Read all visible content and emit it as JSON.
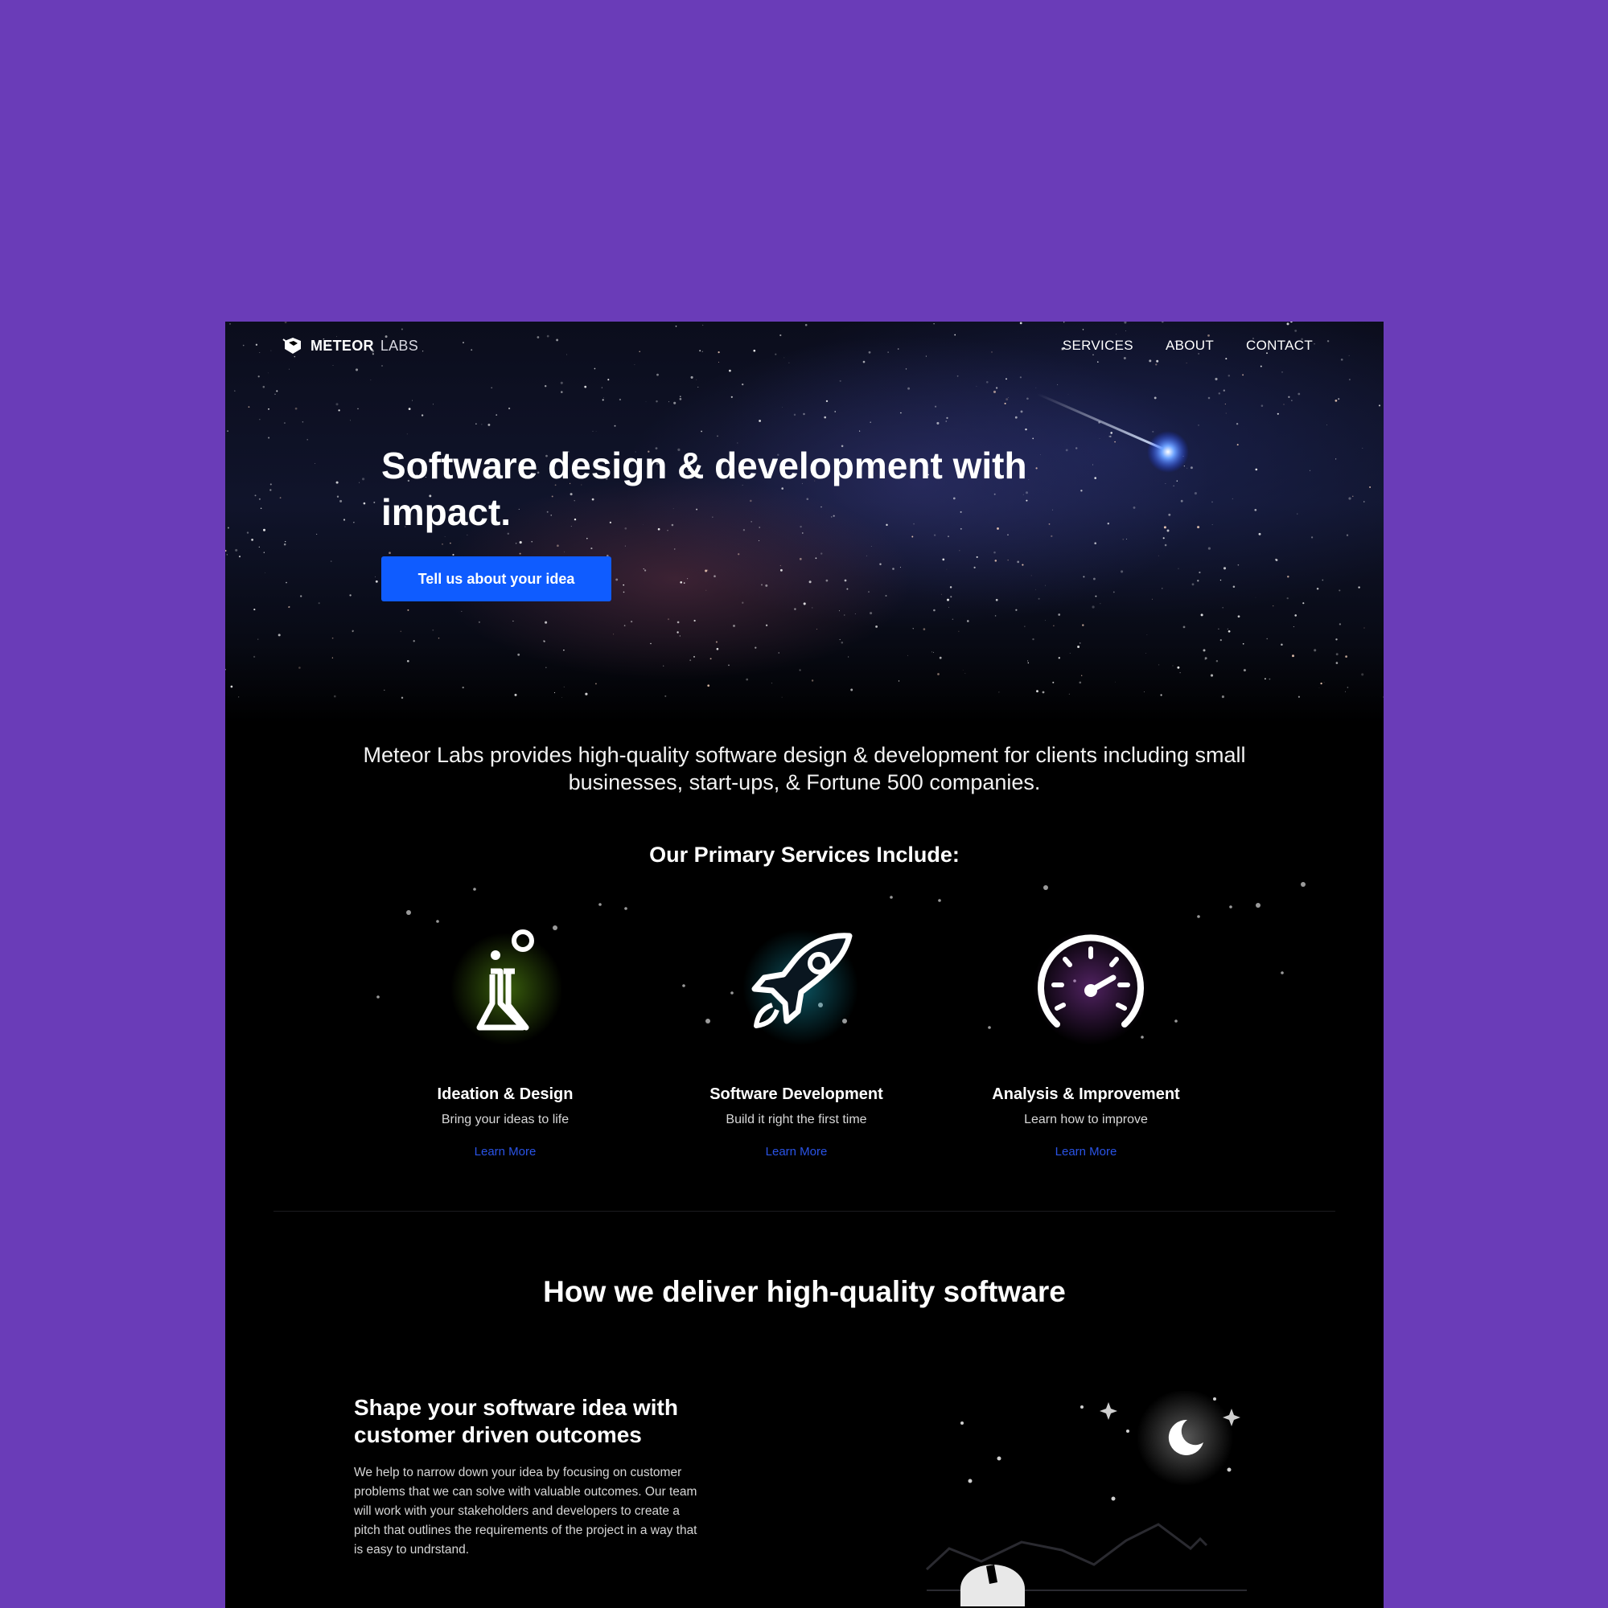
{
  "brand": {
    "name_bold": "METEOR",
    "name_light": "LABS",
    "logo_icon": "meteor-cube-icon"
  },
  "nav": {
    "items": [
      {
        "label": "SERVICES"
      },
      {
        "label": "ABOUT"
      },
      {
        "label": "CONTACT"
      }
    ]
  },
  "hero": {
    "title": "Software design & development with impact.",
    "cta_label": "Tell us about your idea"
  },
  "intro": "Meteor Labs provides high-quality software design & development for clients including small businesses, start-ups, & Fortune 500 companies.",
  "services": {
    "heading": "Our Primary Services Include:",
    "items": [
      {
        "title": "Ideation & Design",
        "subtitle": "Bring your ideas to life",
        "link": "Learn More",
        "icon": "flask-icon",
        "glow": "#7fd11b"
      },
      {
        "title": "Software Development",
        "subtitle": "Build it right the first time",
        "link": "Learn More",
        "icon": "rocket-icon",
        "glow": "#19b9d6"
      },
      {
        "title": "Analysis & Improvement",
        "subtitle": "Learn how to improve",
        "link": "Learn More",
        "icon": "speedometer-icon",
        "glow": "#b14bd6"
      }
    ]
  },
  "delivery": {
    "heading": "How we deliver high-quality software",
    "section_title": "Shape your software idea with customer driven outcomes",
    "section_body": "We help to narrow down your idea by focusing on customer problems that we can solve with valuable outcomes. Our team will work with your stakeholders and developers to create a pitch that outlines the requirements of the project in a way that is easy to undrstand.",
    "illustration_icon": "observatory-night-illustration"
  },
  "colors": {
    "page_bg": "#6a3cb8",
    "site_bg": "#000000",
    "cta": "#0f5cff",
    "link": "#2a53e6"
  }
}
